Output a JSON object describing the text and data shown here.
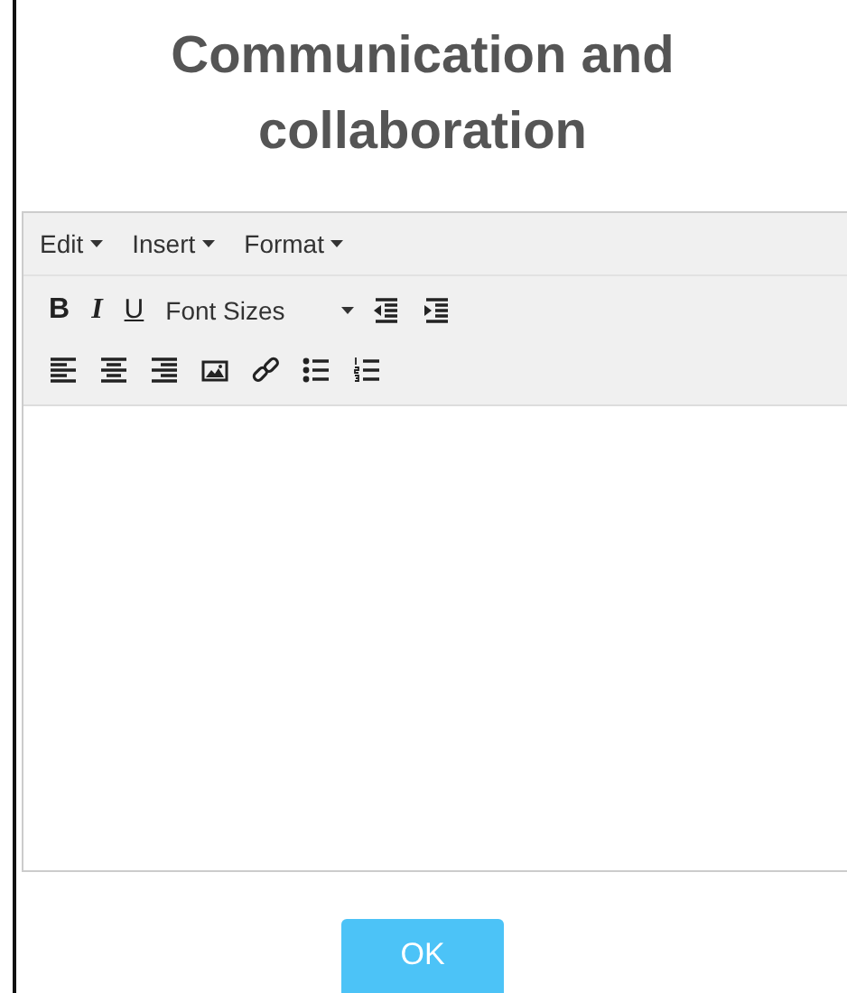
{
  "dialog": {
    "title": "Communication and collaboration"
  },
  "editor": {
    "menus": [
      {
        "label": "Edit"
      },
      {
        "label": "Insert"
      },
      {
        "label": "Format"
      }
    ],
    "toolbar_rows": [
      [
        {
          "kind": "bold",
          "label": "B"
        },
        {
          "kind": "italic",
          "label": "I"
        },
        {
          "kind": "underline",
          "label": "U"
        },
        {
          "kind": "select",
          "label": "Font Sizes"
        },
        {
          "kind": "outdent"
        },
        {
          "kind": "indent"
        }
      ],
      [
        {
          "kind": "align-left"
        },
        {
          "kind": "align-center"
        },
        {
          "kind": "align-right"
        },
        {
          "kind": "image"
        },
        {
          "kind": "link"
        },
        {
          "kind": "bullet-list"
        },
        {
          "kind": "numbered-list"
        }
      ]
    ]
  },
  "buttons": [
    {
      "label": "OK"
    }
  ]
}
